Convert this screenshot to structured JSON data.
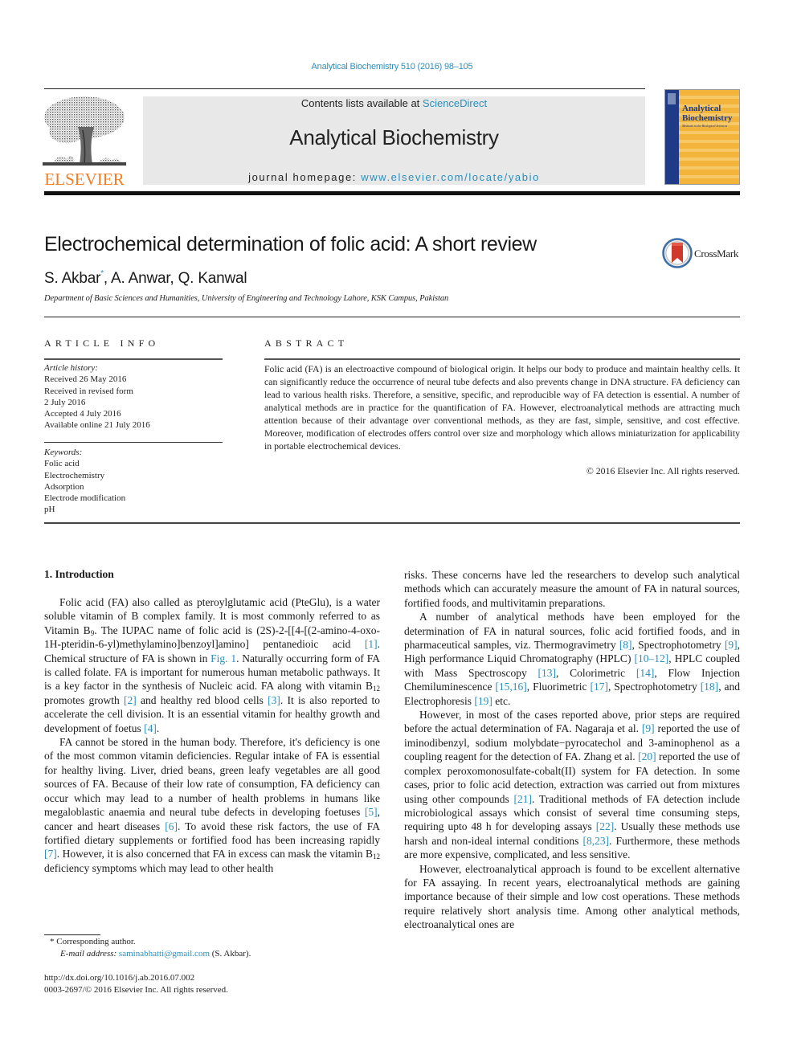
{
  "header": {
    "journal_citation": "Analytical Biochemistry 510 (2016) 98–105",
    "publisher_wordmark": "ELSEVIER",
    "contents_prefix": "Contents lists available at ",
    "contents_link": "ScienceDirect",
    "journal_title": "Analytical Biochemistry",
    "homepage_prefix": "journal homepage: ",
    "homepage_link": "www.elsevier.com/locate/yabio",
    "cover": {
      "title_line1": "Analytical",
      "title_line2": "Biochemistry",
      "subtitle": "Methods in the Biological Sciences"
    },
    "colors": {
      "link": "#2a8fbd",
      "elsevier_orange": "#f07e26",
      "banner_bg": "#e8e8e8",
      "cover_gold": "#f2b43a",
      "cover_blue": "#1f3b87"
    }
  },
  "article": {
    "title": "Electrochemical determination of folic acid: A short review",
    "crossmark_label": "CrossMark",
    "authors": [
      {
        "name": "S. Akbar",
        "marker": "*"
      },
      {
        "name": ", A. Anwar, Q. Kanwal",
        "marker": ""
      }
    ],
    "affiliation": "Department of Basic Sciences and Humanities, University of Engineering and Technology Lahore, KSK Campus, Pakistan"
  },
  "article_info": {
    "heading": "ARTICLE INFO",
    "history_label": "Article history:",
    "history": [
      "Received 26 May 2016",
      "Received in revised form",
      "2 July 2016",
      "Accepted 4 July 2016",
      "Available online 21 July 2016"
    ],
    "keywords_label": "Keywords:",
    "keywords": [
      "Folic acid",
      "Electrochemistry",
      "Adsorption",
      "Electrode modification",
      "pH"
    ]
  },
  "abstract": {
    "heading": "ABSTRACT",
    "text": "Folic acid (FA) is an electroactive compound of biological origin. It helps our body to produce and maintain healthy cells. It can significantly reduce the occurrence of neural tube defects and also prevents change in DNA structure. FA deficiency can lead to various health risks. Therefore, a sensitive, specific, and reproducible way of FA detection is essential. A number of analytical methods are in practice for the quantification of FA. However, electroanalytical methods are attracting much attention because of their advantage over conventional methods, as they are fast, simple, sensitive, and cost effective. Moreover, modification of electrodes offers control over size and morphology which allows miniaturization for applicability in portable electrochemical devices.",
    "copyright": "© 2016 Elsevier Inc. All rights reserved."
  },
  "body": {
    "section_heading": "1.  Introduction",
    "left": {
      "p1": [
        {
          "t": "Folic acid (FA) also called as pteroylglutamic acid (PteGlu), is a water soluble vitamin of B complex family. It is most commonly referred to as Vitamin B"
        },
        {
          "sub": "9"
        },
        {
          "t": ". The IUPAC name of folic acid is (2S)-2-[[4-[(2-amino-4-oxo-1H-pteridin-6-yl)methylamino]benzoyl]amino] pentanedioic acid "
        },
        {
          "ref": "[1]"
        },
        {
          "t": ". Chemical structure of FA is shown in "
        },
        {
          "ref": "Fig. 1"
        },
        {
          "t": ". Naturally occurring form of FA is called folate. FA is important for numerous human metabolic pathways. It is a key factor in the synthesis of Nucleic acid. FA along with vitamin B"
        },
        {
          "sub": "12"
        },
        {
          "t": " promotes growth "
        },
        {
          "ref": "[2]"
        },
        {
          "t": " and healthy red blood cells "
        },
        {
          "ref": "[3]"
        },
        {
          "t": ". It is also reported to accelerate the cell division. It is an essential vitamin for healthy growth and development of foetus "
        },
        {
          "ref": "[4]"
        },
        {
          "t": "."
        }
      ],
      "p2": [
        {
          "t": "FA cannot be stored in the human body. Therefore, it's deficiency is one of the most common vitamin deficiencies. Regular intake of FA is essential for healthy living. Liver, dried beans, green leafy vegetables are all good sources of FA. Because of their low rate of consumption, FA deficiency can occur which may lead to a number of health problems in humans like megaloblastic anaemia and neural tube defects in developing foetuses "
        },
        {
          "ref": "[5]"
        },
        {
          "t": ", cancer and heart diseases "
        },
        {
          "ref": "[6]"
        },
        {
          "t": ". To avoid these risk factors, the use of FA fortified dietary supplements or fortified food has been increasing rapidly "
        },
        {
          "ref": "[7]"
        },
        {
          "t": ". However, it is also concerned that FA in excess can mask the vitamin B"
        },
        {
          "sub": "12"
        },
        {
          "t": " deficiency symptoms which may lead to other health"
        }
      ]
    },
    "right": {
      "p0": [
        {
          "t": "risks. These concerns have led the researchers to develop such analytical methods which can accurately measure the amount of FA in natural sources, fortified foods, and multivitamin preparations."
        }
      ],
      "p1": [
        {
          "t": "A number of analytical methods have been employed for the determination of FA in natural sources, folic acid fortified foods, and in pharmaceutical samples, viz. Thermogravimetry "
        },
        {
          "ref": "[8]"
        },
        {
          "t": ", Spectrophotometry "
        },
        {
          "ref": "[9]"
        },
        {
          "t": ", High performance Liquid Chromatography (HPLC) "
        },
        {
          "ref": "[10–12]"
        },
        {
          "t": ", HPLC coupled with Mass Spectroscopy "
        },
        {
          "ref": "[13]"
        },
        {
          "t": ", Colorimetric "
        },
        {
          "ref": "[14]"
        },
        {
          "t": ", Flow Injection Chemiluminescence "
        },
        {
          "ref": "[15,16]"
        },
        {
          "t": ", Fluorimetric "
        },
        {
          "ref": "[17]"
        },
        {
          "t": ", Spectrophotometry "
        },
        {
          "ref": "[18]"
        },
        {
          "t": ", and Electrophoresis "
        },
        {
          "ref": "[19]"
        },
        {
          "t": " etc."
        }
      ],
      "p2": [
        {
          "t": "However, in most of the cases reported above, prior steps are required before the actual determination of FA. Nagaraja et al. "
        },
        {
          "ref": "[9]"
        },
        {
          "t": " reported the use of iminodibenzyl, sodium molybdate−pyrocatechol and 3-aminophenol as a coupling reagent for the detection of FA. Zhang et al. "
        },
        {
          "ref": "[20]"
        },
        {
          "t": " reported the use of complex peroxomonosulfate-cobalt(II) system for FA detection. In some cases, prior to folic acid detection, extraction was carried out from mixtures using other compounds "
        },
        {
          "ref": "[21]"
        },
        {
          "t": ". Traditional methods of FA detection include microbiological assays which consist of several time consuming steps, requiring upto 48 h for developing assays "
        },
        {
          "ref": "[22]"
        },
        {
          "t": ". Usually these methods use harsh and non-ideal internal conditions "
        },
        {
          "ref": "[8,23]"
        },
        {
          "t": ". Furthermore, these methods are more expensive, complicated, and less sensitive."
        }
      ],
      "p3": [
        {
          "t": "However, electroanalytical approach is found to be excellent alternative for FA assaying. In recent years, electroanalytical methods are gaining importance because of their simple and low cost operations. These methods require relatively short analysis time. Among other analytical methods, electroanalytical ones are"
        }
      ]
    }
  },
  "footer": {
    "corresponding": "*  Corresponding author.",
    "email_label": "E-mail address: ",
    "email": "saminabhatti@gmail.com",
    "email_suffix": " (S. Akbar).",
    "doi": "http://dx.doi.org/10.1016/j.ab.2016.07.002",
    "issn_line": "0003-2697/© 2016 Elsevier Inc. All rights reserved."
  }
}
